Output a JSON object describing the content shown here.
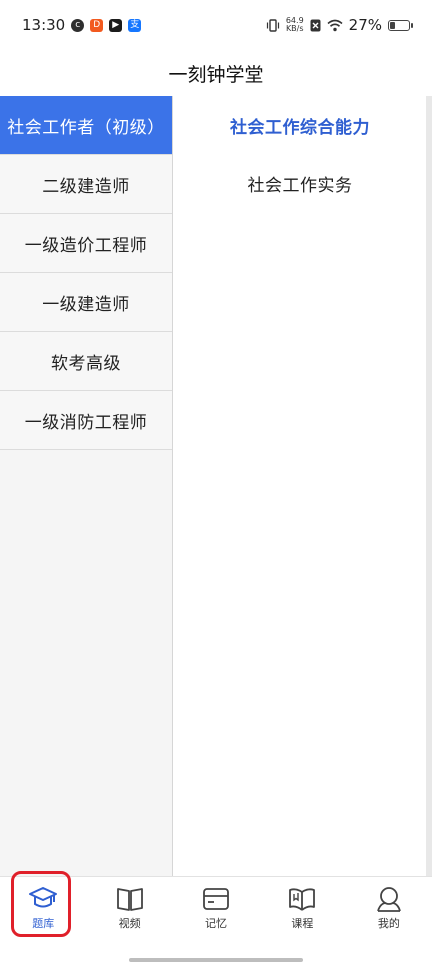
{
  "status_bar": {
    "time": "13:30",
    "app_icons": [
      "c",
      "D",
      "▶",
      "支"
    ],
    "net_speed_value": "64.9",
    "net_speed_unit": "KB/s",
    "battery_text": "27%",
    "battery_level": 0.27
  },
  "header": {
    "title": "一刻钟学堂"
  },
  "left_list": {
    "items": [
      {
        "label": "社会工作者（初级）",
        "active": true
      },
      {
        "label": "二级建造师",
        "active": false
      },
      {
        "label": "一级造价工程师",
        "active": false
      },
      {
        "label": "一级建造师",
        "active": false
      },
      {
        "label": "软考高级",
        "active": false
      },
      {
        "label": "一级消防工程师",
        "active": false
      }
    ]
  },
  "right_list": {
    "items": [
      {
        "label": "社会工作综合能力",
        "active": true
      },
      {
        "label": "社会工作实务",
        "active": false
      }
    ]
  },
  "tab_bar": {
    "tabs": [
      {
        "label": "题库",
        "icon": "graduation-cap-icon",
        "active": true
      },
      {
        "label": "视频",
        "icon": "book-icon",
        "active": false
      },
      {
        "label": "记忆",
        "icon": "card-icon",
        "active": false
      },
      {
        "label": "课程",
        "icon": "open-book-icon",
        "active": false
      },
      {
        "label": "我的",
        "icon": "user-icon",
        "active": false
      }
    ]
  },
  "colors": {
    "accent": "#3b73e8",
    "active_text": "#2f5fd1",
    "highlight_border": "#e0202a"
  }
}
